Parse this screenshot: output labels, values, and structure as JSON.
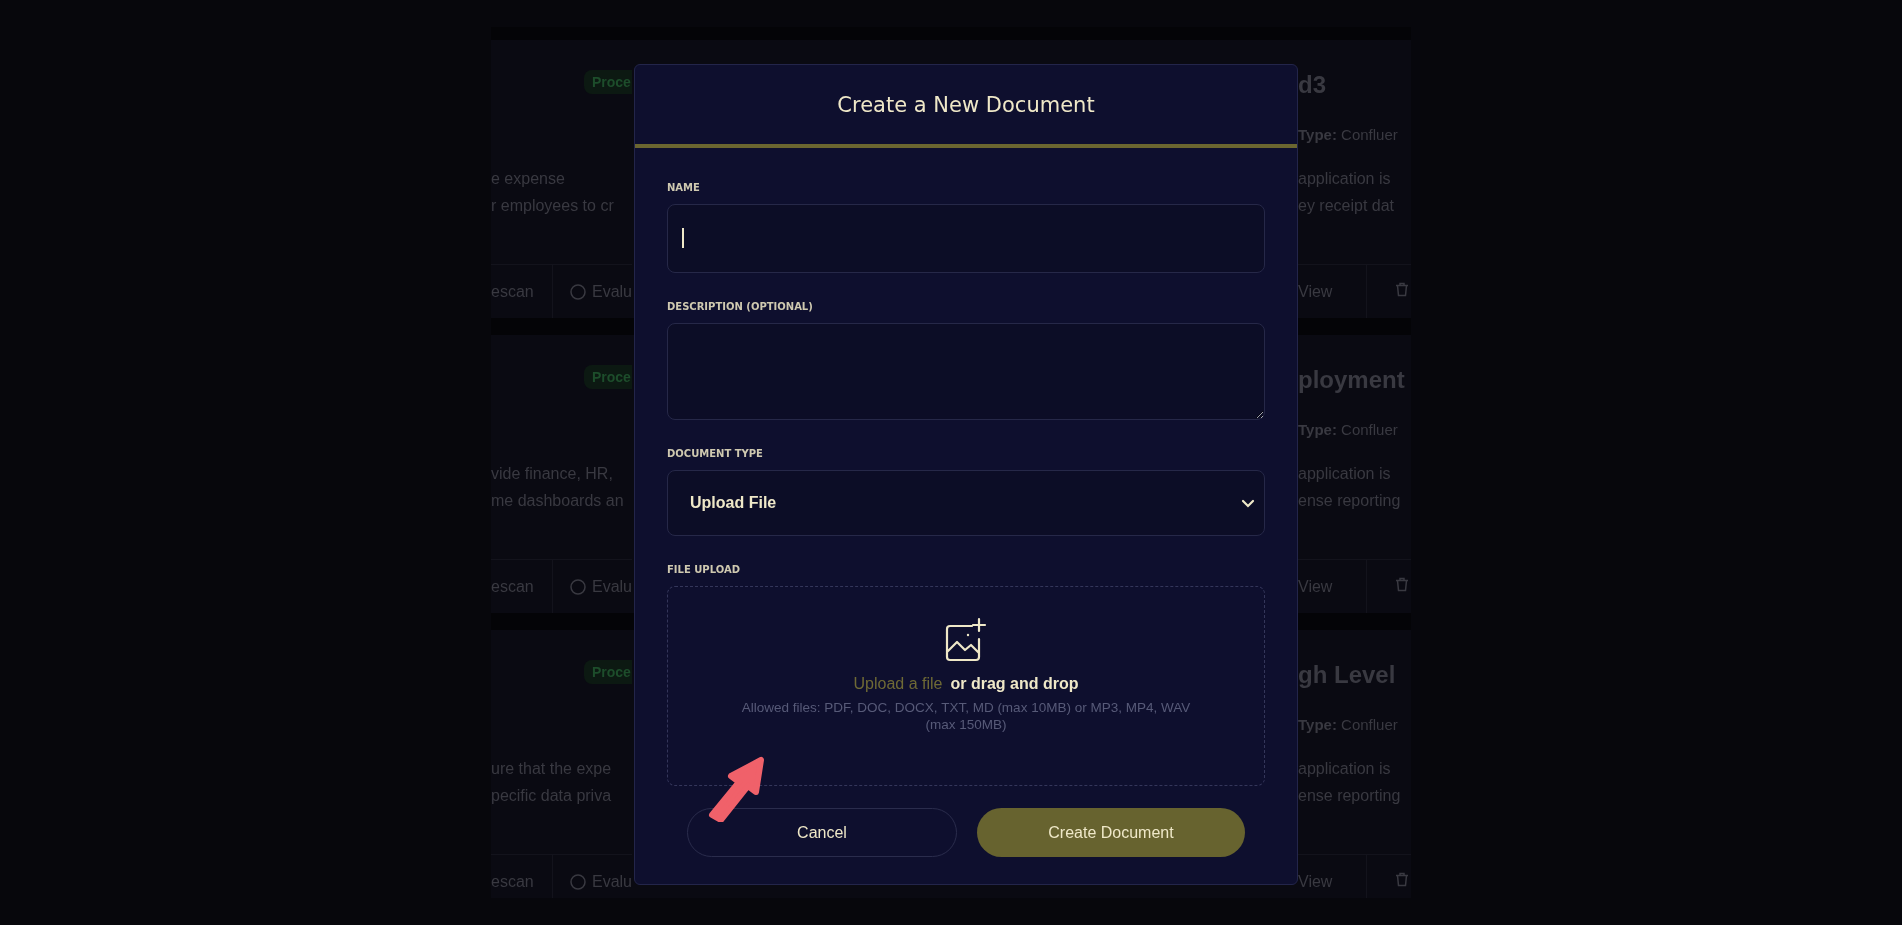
{
  "background_cards": {
    "left_column": [
      {
        "badge": "Proce",
        "description_lines": [
          "e expense",
          "r employees to cr"
        ],
        "actions": [
          "escan",
          "Evalu"
        ]
      },
      {
        "badge": "Proce",
        "description_lines": [
          "vide finance, HR,",
          "me dashboards an"
        ],
        "actions": [
          "escan",
          "Evalu"
        ]
      },
      {
        "badge": "Proce",
        "description_lines": [
          "ure that the expe",
          "pecific data priva"
        ],
        "actions": [
          "escan",
          "Evalu"
        ]
      }
    ],
    "right_column": [
      {
        "title": "d3",
        "type_line": "**Type:** Confluer",
        "description_lines": [
          "application is",
          "ey receipt dat"
        ],
        "actions": [
          "View"
        ]
      },
      {
        "title": "ployment",
        "type_line": "**Type:** Confluer",
        "description_lines": [
          "application is",
          "ense reporting"
        ],
        "actions": [
          "View"
        ]
      },
      {
        "title": "gh Level",
        "type_line": "**Type:** Confluer",
        "description_lines": [
          "application is",
          "ense reporting"
        ],
        "actions": [
          "View"
        ]
      }
    ]
  },
  "dialog": {
    "title": "Create a New Document",
    "fields": [
      {
        "kind": "text",
        "label": "NAME",
        "focused": true
      },
      {
        "kind": "textarea",
        "label": "DESCRIPTION (OPTIONAL)"
      },
      {
        "kind": "select",
        "label": "DOCUMENT TYPE",
        "value": "Upload File"
      },
      {
        "kind": "upload",
        "label": "FILE UPLOAD",
        "link": "Upload a file",
        "text": "or drag and drop",
        "hint": "Allowed files: PDF, DOC, DOCX, TXT, MD (max 10MB) or MP3, MP4, WAV (max 150MB)"
      }
    ],
    "buttons": [
      {
        "label": "Cancel",
        "kind": "secondary"
      },
      {
        "label": "Create Document",
        "kind": "primary"
      }
    ]
  }
}
